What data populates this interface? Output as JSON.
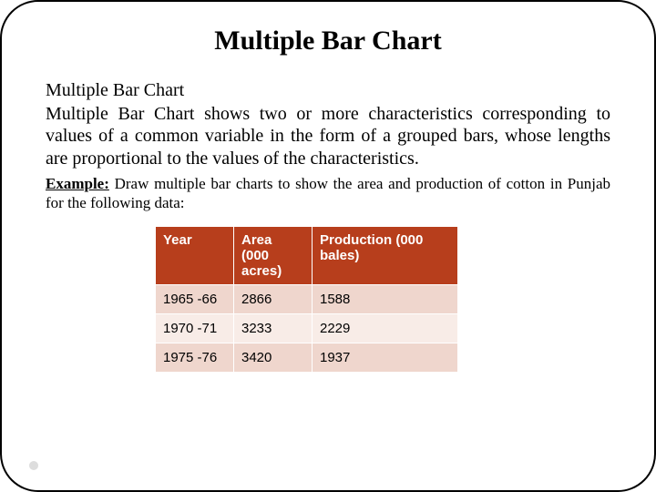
{
  "title": "Multiple Bar Chart",
  "subtitle": "Multiple Bar Chart",
  "description": "Multiple Bar Chart shows two or more characteristics corresponding to  values of a common variable in the form of a grouped bars, whose lengths are proportional to the values of the characteristics.",
  "example_label": "Example:",
  "example_text": " Draw multiple bar charts to show the area and production of cotton in Punjab for the following data:",
  "table": {
    "headers": {
      "year": "Year",
      "area": "Area (000 acres)",
      "production": "Production (000 bales)"
    },
    "rows": [
      {
        "year": "1965 -66",
        "area": "2866",
        "production": "1588"
      },
      {
        "year": "1970 -71",
        "area": "3233",
        "production": "2229"
      },
      {
        "year": "1975 -76",
        "area": "3420",
        "production": "1937"
      }
    ]
  },
  "chart_data": {
    "type": "table",
    "title": "Area and production of cotton in Punjab",
    "categories": [
      "1965-66",
      "1970-71",
      "1975-76"
    ],
    "series": [
      {
        "name": "Area (000 acres)",
        "values": [
          2866,
          3233,
          3420
        ]
      },
      {
        "name": "Production (000 bales)",
        "values": [
          1588,
          2229,
          1937
        ]
      }
    ]
  }
}
